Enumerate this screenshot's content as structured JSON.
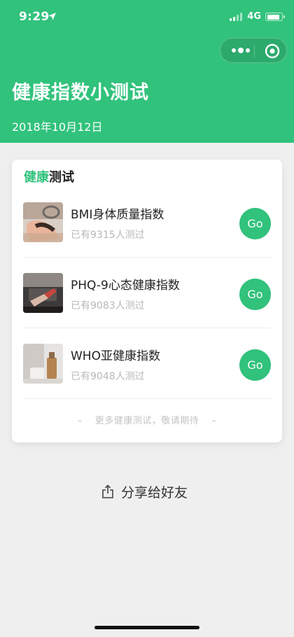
{
  "status_bar": {
    "time": "9:29",
    "network": "4G"
  },
  "header": {
    "title": "健康指数小测试",
    "date": "2018年10月12日"
  },
  "colors": {
    "brand_green": "#31c27c",
    "background": "#efefef",
    "muted_text": "#b8b8b8"
  },
  "card": {
    "title_accent": "健康",
    "title_rest": "测试",
    "items": [
      {
        "name": "BMI身体质量指数",
        "count": "已有9315人测过",
        "button": "Go",
        "thumb_icon": "bmi-photo-icon"
      },
      {
        "name": "PHQ-9心态健康指数",
        "count": "已有9083人测过",
        "button": "Go",
        "thumb_icon": "phq9-photo-icon"
      },
      {
        "name": "WHO亚健康指数",
        "count": "已有9048人测过",
        "button": "Go",
        "thumb_icon": "who-photo-icon"
      }
    ],
    "more_text": "更多健康测试，敬请期待",
    "more_dash": "–"
  },
  "share": {
    "label": "分享给好友",
    "icon": "share-icon"
  },
  "capsule": {
    "more_icon": "more-dots-icon",
    "close_icon": "target-circle-icon"
  }
}
